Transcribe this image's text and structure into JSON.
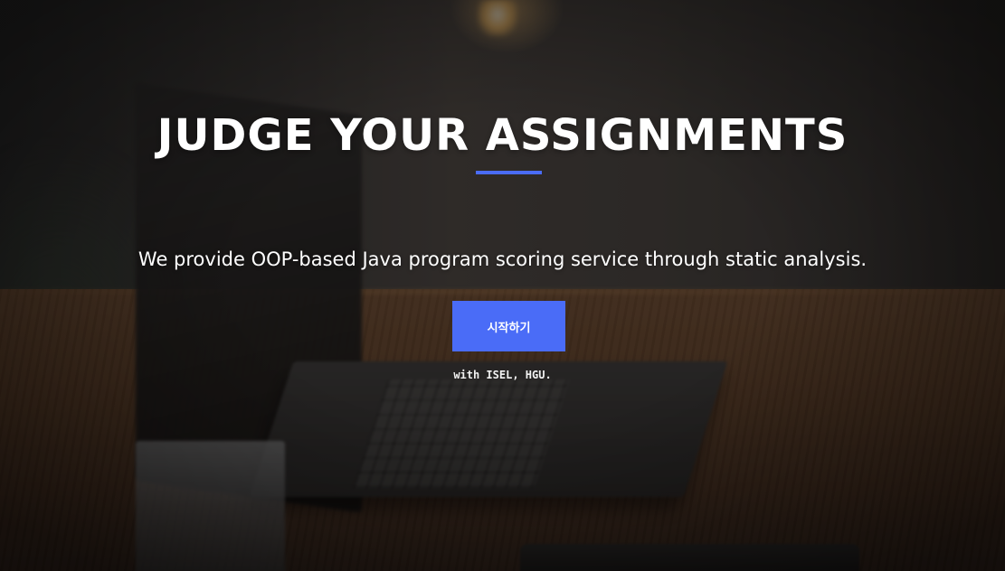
{
  "hero": {
    "title": "JUDGE YOUR ASSIGNMENTS",
    "subtitle": "We provide OOP-based Java program scoring service through static analysis.",
    "start_button_label": "시작하기",
    "credit": "with ISEL, HGU."
  },
  "colors": {
    "accent": "#4a6cf7",
    "text": "#ffffff"
  }
}
